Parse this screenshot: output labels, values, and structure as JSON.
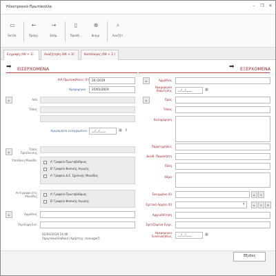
{
  "window": {
    "title": "Ηλεκτρονικό Πρωτόκολλο",
    "controls": {
      "min": "–",
      "restore": "❐",
      "close": "✕"
    }
  },
  "toolbar": {
    "buttons": [
      {
        "icon": "save-icon",
        "glyph": "▭",
        "label": "Εκτύπ."
      },
      {
        "icon": "back-icon",
        "glyph": "←",
        "label": "Προηγ."
      },
      {
        "icon": "forward-icon",
        "glyph": "→",
        "label": "Επόμ."
      },
      {
        "icon": "document-icon",
        "glyph": "▯",
        "label": "Προσθ..."
      },
      {
        "icon": "delete-icon",
        "glyph": "⊗",
        "label": "Διαγρ."
      },
      {
        "icon": "search-icon",
        "glyph": "⌕",
        "label": "Αναζήτ."
      }
    ]
  },
  "tabs": [
    {
      "label": "Εγγραφή (Alt + 1)",
      "active": true
    },
    {
      "label": "Αναζήτηση  (Alt + 2)",
      "active": false
    },
    {
      "label": "Κατάλογος  (Alt + 3 )",
      "active": false
    }
  ],
  "incoming": {
    "title": "ΕΙΣΕΡΧΟΜΕΝΑ",
    "protocol_label": "Α/Α Πρωτοκόλλου / Έτος",
    "protocol_value": "20 /2019",
    "date_label": "Ημερομηνία",
    "date_value": "25/01/2019",
    "from_label": "Από",
    "place_label": "Τόπος",
    "entry_date_label": "Ημερομηνία εισερχομένου",
    "entry_date_value": "__/__/____",
    "place_of_publication_label": "Τόπος Προέλευσης",
    "responsible_unit_label": "Υπεύθυνη Μονάδα",
    "units": [
      "Α' Γραφείο Πρωτοβάθμιας",
      "Β' Γραφείο Φυσικής Αγωγής",
      "Α' Γραφείο Δ.Ε. Σχολικής Μονάδας"
    ],
    "copy_label": "Αντίγραφο στις Μονάδες",
    "copy_units": [
      "Α' Γραφείο Πρωτοβάθμιας",
      "Β' Γραφείο Φυσικής Αγωγής"
    ],
    "file_label": "Αρμόδιος",
    "notes_label": "Περίληψη Εισ.",
    "footer_line1": "02/04/2019 14:46",
    "footer_line2": "[πρωτοκολληθηκε] Χρήστης: manager5"
  },
  "outgoing": {
    "title": "ΕΞΕΡΧΟΜΕΝΑ",
    "responsible_label": "Αρμόδιος",
    "reply_date_label": "Ημερομηνία Απάντησης",
    "reply_date_value": "__/__/____",
    "to_label": "Προς",
    "place_label": "Τόπος",
    "summary_label": "Καταχώρηση",
    "notes_label": "Παρατηρήσεις",
    "remarks_label": "Διεύθ. Παραλήπτη",
    "city_label": "Πόλη",
    "subject_label": "Θέμα",
    "attachments_label": "Συνημμένα (0)",
    "related_label": "Σχετικά Αρχεία (0)",
    "archive_label": "Αρχειοθέτηση",
    "related_docs_label": "Σχετιζόμενο Έγγρ.",
    "expiry_label": "Ημερομηνία Συνεννοήσεως",
    "expiry_value": "__/__/____"
  },
  "bottom": {
    "exit_label": "Έξοδος"
  }
}
